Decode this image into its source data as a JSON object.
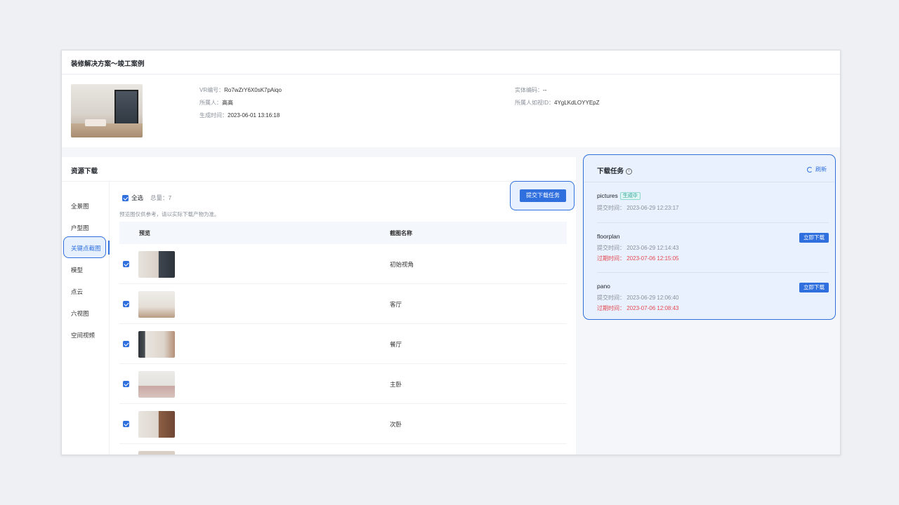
{
  "header": {
    "title": "装修解决方案～竣工案例"
  },
  "info": {
    "vr_label": "VR编号：",
    "vr_value": "Ro7wZrY6X0sK7pAiqo",
    "owner_label": "所属人：",
    "owner_value": "高高",
    "time_label": "生成时间：",
    "time_value": "2023-06-01 13:16:18",
    "entity_label": "实体编码：",
    "entity_value": "--",
    "owner_id_label": "所属人如视ID：",
    "owner_id_value": "4YgLKdLOYYEpZ"
  },
  "resource": {
    "title": "资源下载",
    "nav": [
      "全景图",
      "户型图",
      "关键点截图",
      "模型",
      "点云",
      "六视图",
      "空间视频"
    ],
    "active_nav": "关键点截图",
    "select_all": "全选",
    "total": "总量：7",
    "note": "预览图仅供参考，请以实际下载产物为准。",
    "submit": "提交下载任务",
    "columns": {
      "preview": "预览",
      "name": "截图名称"
    },
    "rows": [
      {
        "name": "初始视角"
      },
      {
        "name": "客厅"
      },
      {
        "name": "餐厅"
      },
      {
        "name": "主卧"
      },
      {
        "name": "次卧"
      }
    ]
  },
  "tasks": {
    "title": "下载任务",
    "refresh": "刷新",
    "items": [
      {
        "name": "pictures",
        "status": "生成中",
        "submit": "提交时间：  2023-06-29 12:23:17"
      },
      {
        "name": "floorplan",
        "submit": "提交时间：  2023-06-29 12:14:43",
        "expire": "过期时间：  2023-07-06 12:15:05",
        "action": "立即下载"
      },
      {
        "name": "pano",
        "submit": "提交时间：  2023-06-29 12:06:40",
        "expire": "过期时间：  2023-07-06 12:08:43",
        "action": "立即下载"
      }
    ]
  },
  "colors": {
    "accent": "#2f6fde",
    "danger": "#e5484d",
    "highlight_bg": "#e8f1fd"
  }
}
